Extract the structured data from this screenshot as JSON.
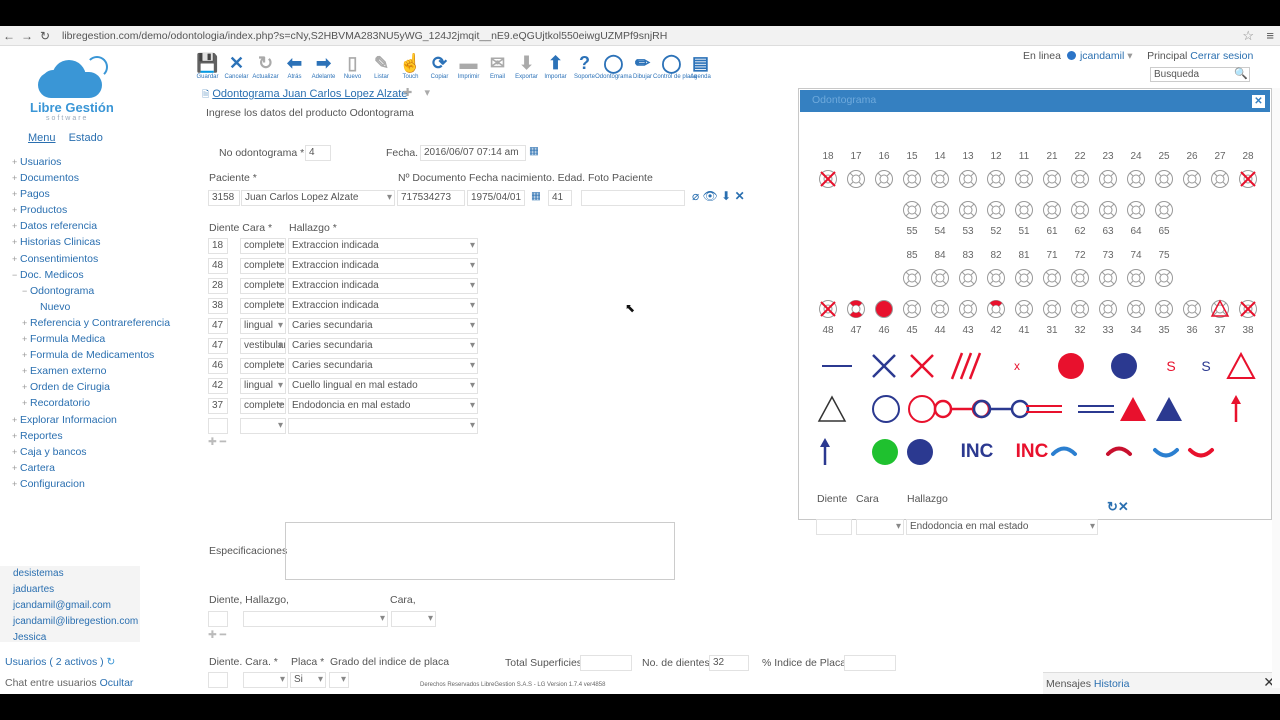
{
  "browser": {
    "url": "libregestion.com/demo/odontologia/index.php?s=cNy,S2HBVMA283NU5yWG_124J2jmqit__nE9.eQGUjtkol550eiwgUZMPf9snjRH"
  },
  "logo": {
    "name": "Libre Gestión",
    "tagline": "software"
  },
  "menu_tabs": {
    "menu": "Menu",
    "estado": "Estado"
  },
  "sidebar": [
    {
      "prefix": "+",
      "label": "Usuarios",
      "indent": 0
    },
    {
      "prefix": "+",
      "label": "Documentos",
      "indent": 0
    },
    {
      "prefix": "+",
      "label": "Pagos",
      "indent": 0
    },
    {
      "prefix": "+",
      "label": "Productos",
      "indent": 0
    },
    {
      "prefix": "+",
      "label": "Datos referencia",
      "indent": 0
    },
    {
      "prefix": "+",
      "label": "Historias Clinicas",
      "indent": 0
    },
    {
      "prefix": "+",
      "label": "Consentimientos",
      "indent": 0
    },
    {
      "prefix": "−",
      "label": "Doc. Medicos",
      "indent": 0
    },
    {
      "prefix": "−",
      "label": "Odontograma",
      "indent": 1
    },
    {
      "prefix": "",
      "label": "Nuevo",
      "indent": 2
    },
    {
      "prefix": "+",
      "label": "Referencia y Contrareferencia",
      "indent": 1
    },
    {
      "prefix": "+",
      "label": "Formula Medica",
      "indent": 1
    },
    {
      "prefix": "+",
      "label": "Formula de Medicamentos",
      "indent": 1
    },
    {
      "prefix": "+",
      "label": "Examen externo",
      "indent": 1
    },
    {
      "prefix": "+",
      "label": "Orden de Cirugia",
      "indent": 1
    },
    {
      "prefix": "+",
      "label": "Recordatorio",
      "indent": 1
    },
    {
      "prefix": "+",
      "label": "Explorar Informacion",
      "indent": 0
    },
    {
      "prefix": "+",
      "label": "Reportes",
      "indent": 0
    },
    {
      "prefix": "+",
      "label": "Caja y bancos",
      "indent": 0
    },
    {
      "prefix": "+",
      "label": "Cartera",
      "indent": 0
    },
    {
      "prefix": "+",
      "label": "Configuracion",
      "indent": 0
    }
  ],
  "users": [
    "desistemas",
    "jaduartes",
    "jcandamil@gmail.com",
    "jcandamil@libregestion.com",
    "Jessica"
  ],
  "users_footer": "Usuarios ( 2 activos )",
  "chat_footer": {
    "text": "Chat entre usuarios",
    "link": "Ocultar"
  },
  "toolbar": [
    {
      "icon": "save-icon",
      "glyph": "💾",
      "label": "Guardar"
    },
    {
      "icon": "cancel-icon",
      "glyph": "✕",
      "label": "Cancelar"
    },
    {
      "icon": "refresh-icon",
      "glyph": "↻",
      "label": "Actualizar",
      "gray": true
    },
    {
      "icon": "back-icon",
      "glyph": "⬅",
      "label": "Atrás"
    },
    {
      "icon": "forward-icon",
      "glyph": "➡",
      "label": "Adelante"
    },
    {
      "icon": "new-icon",
      "glyph": "▯",
      "label": "Nuevo",
      "gray": true
    },
    {
      "icon": "list-icon",
      "glyph": "✎",
      "label": "Listar",
      "gray": true
    },
    {
      "icon": "touch-icon",
      "glyph": "☝",
      "label": "Touch"
    },
    {
      "icon": "copy-icon",
      "glyph": "⟳",
      "label": "Copiar"
    },
    {
      "icon": "print-icon",
      "glyph": "▬",
      "label": "Imprimir",
      "gray": true
    },
    {
      "icon": "email-icon",
      "glyph": "✉",
      "label": "Email",
      "gray": true
    },
    {
      "icon": "export-icon",
      "glyph": "⬇",
      "label": "Exportar",
      "gray": true
    },
    {
      "icon": "import-icon",
      "glyph": "⬆",
      "label": "Importar"
    },
    {
      "icon": "help-icon",
      "glyph": "?",
      "label": "Soporte"
    },
    {
      "icon": "odontogram-icon",
      "glyph": "◯",
      "label": "Odontograma"
    },
    {
      "icon": "draw-icon",
      "glyph": "✏",
      "label": "Dibujar"
    },
    {
      "icon": "plaque-icon",
      "glyph": "◯",
      "label": "Control de placa"
    },
    {
      "icon": "agenda-icon",
      "glyph": "▤",
      "label": "Agenda"
    }
  ],
  "doc_tab": "Odontograma Juan Carlos Lopez Alzate",
  "page_hint": "Ingrese los datos del producto  Odontograma",
  "userbar": {
    "status": "En linea",
    "user": "jcandamil",
    "principal": "Principal",
    "logout": "Cerrar sesion",
    "search_placeholder": "Busqueda"
  },
  "form": {
    "no_label": "No odontograma *",
    "no_value": "4",
    "fecha_label": "Fecha.",
    "fecha_value": "2016/06/07 07:14 am",
    "paciente_label": "Paciente *",
    "doc_label": "Nº Documento Fecha nacimiento. Edad. Foto Paciente",
    "paciente_id": "3158",
    "paciente_name": "Juan Carlos Lopez Alzate",
    "documento": "717534273",
    "nacimiento": "1975/04/01",
    "edad": "41",
    "diente_label": "Diente",
    "cara_label": "Cara *",
    "hallazgo_label": "Hallazgo *"
  },
  "findings": [
    {
      "diente": "18",
      "cara": "complete",
      "hallazgo": "Extraccion indicada"
    },
    {
      "diente": "48",
      "cara": "complete",
      "hallazgo": "Extraccion indicada"
    },
    {
      "diente": "28",
      "cara": "complete",
      "hallazgo": "Extraccion indicada"
    },
    {
      "diente": "38",
      "cara": "complete",
      "hallazgo": "Extraccion indicada"
    },
    {
      "diente": "47",
      "cara": "lingual",
      "hallazgo": "Caries secundaria"
    },
    {
      "diente": "47",
      "cara": "vestibular",
      "hallazgo": "Caries secundaria"
    },
    {
      "diente": "46",
      "cara": "complete",
      "hallazgo": "Caries secundaria"
    },
    {
      "diente": "42",
      "cara": "lingual",
      "hallazgo": "Cuello lingual en mal estado"
    },
    {
      "diente": "37",
      "cara": "complete",
      "hallazgo": "Endodoncia en mal estado"
    },
    {
      "diente": "",
      "cara": "",
      "hallazgo": ""
    }
  ],
  "bottom": {
    "especificaciones": "Especificaciones",
    "diente_hallazgo": "Diente, Hallazgo,",
    "cara": "Cara,",
    "diente_cara": "Diente. Cara. *",
    "placa": "Placa *",
    "grado": "Grado del indice de placa",
    "placa_value": "Si",
    "total_superficies": "Total Superficies",
    "no_dientes": "No. de dientes",
    "no_dientes_value": "32",
    "indice_placa": "% Indice de Placa",
    "copyright": "Derechos Reservados LibreGestion S.A.S - LG Version 1.7.4 ver4858",
    "mensajes": "Mensajes",
    "historia": "Historia"
  },
  "odontogram": {
    "title": "Odontograma",
    "upper_permanent": [
      "18",
      "17",
      "16",
      "15",
      "14",
      "13",
      "12",
      "11",
      "21",
      "22",
      "23",
      "24",
      "25",
      "26",
      "27",
      "28"
    ],
    "upper_deciduous": [
      "55",
      "54",
      "53",
      "52",
      "51",
      "61",
      "62",
      "63",
      "64",
      "65"
    ],
    "lower_deciduous": [
      "85",
      "84",
      "83",
      "82",
      "81",
      "71",
      "72",
      "73",
      "74",
      "75"
    ],
    "lower_permanent": [
      "48",
      "47",
      "46",
      "45",
      "44",
      "43",
      "42",
      "41",
      "31",
      "32",
      "33",
      "34",
      "35",
      "36",
      "37",
      "38"
    ],
    "marked_upper": {
      "18": "extract",
      "28": "extract"
    },
    "marked_lower": {
      "48": "extract",
      "47": "caries-lv",
      "46": "full-red",
      "42": "lingual-red",
      "37": "endo",
      "38": "extract"
    },
    "diente_label": "Diente",
    "cara_label": "Cara",
    "hallazgo_label": "Hallazgo",
    "hallazgo_value": "Endodoncia en mal estado",
    "legend_text": {
      "inc1": "INC",
      "inc2": "INC",
      "s1": "S",
      "s2": "S",
      "x": "x"
    },
    "colors": {
      "red": "#e8112d",
      "blue": "#2b3990",
      "green": "#1fc12f",
      "header": "#3580c1"
    }
  }
}
